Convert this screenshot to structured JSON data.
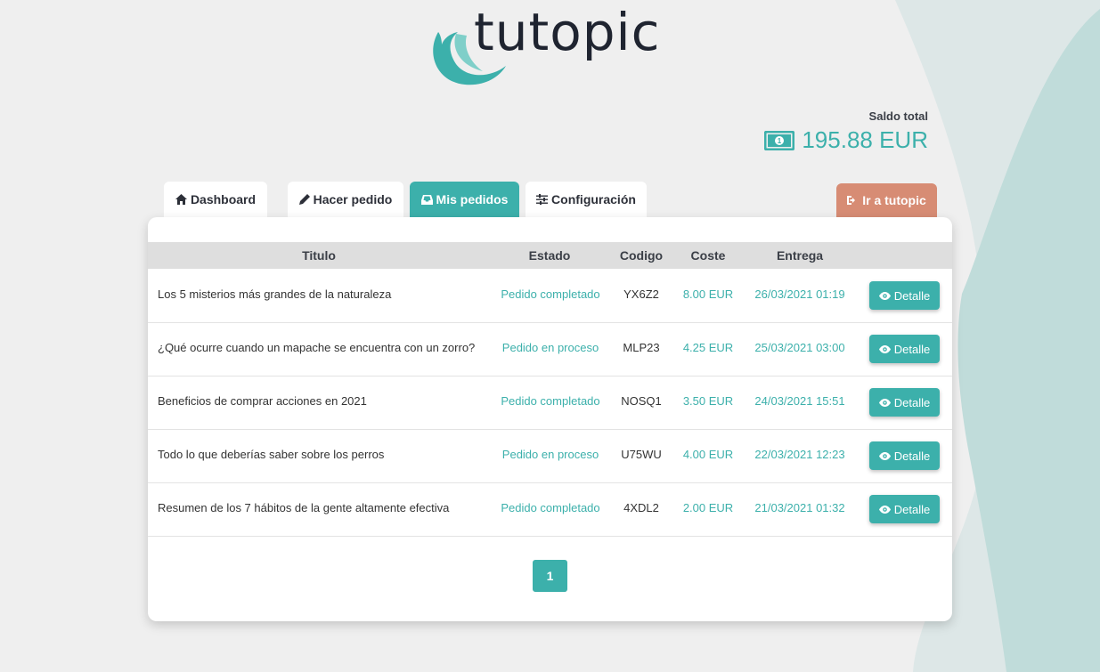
{
  "brand": {
    "logo_text": "tutopic",
    "accent": "#3cb0ab",
    "external_color": "#d78c74"
  },
  "balance": {
    "label": "Saldo total",
    "amount": "195.88 EUR",
    "icon": "money-bill-icon"
  },
  "tabs": [
    {
      "label": "Dashboard",
      "icon": "home-icon",
      "active": false
    },
    {
      "label": "Hacer pedido",
      "icon": "pencil-icon",
      "active": false
    },
    {
      "label": "Mis pedidos",
      "icon": "inbox-icon",
      "active": true
    },
    {
      "label": "Configuración",
      "icon": "sliders-icon",
      "active": false
    }
  ],
  "external": {
    "label": "Ir a tutopic",
    "icon": "sign-out-icon"
  },
  "table": {
    "headers": {
      "title": "Titulo",
      "status": "Estado",
      "code": "Codigo",
      "cost": "Coste",
      "delivery": "Entrega"
    },
    "rows": [
      {
        "title": "Los 5 misterios más grandes de la naturaleza",
        "status": "Pedido completado",
        "code": "YX6Z2",
        "cost": "8.00 EUR",
        "delivery": "26/03/2021 01:19",
        "action": "Detalle"
      },
      {
        "title": "¿Qué ocurre cuando un mapache se encuentra con un zorro?",
        "status": "Pedido en proceso",
        "code": "MLP23",
        "cost": "4.25 EUR",
        "delivery": "25/03/2021 03:00",
        "action": "Detalle"
      },
      {
        "title": "Beneficios de comprar acciones en 2021",
        "status": "Pedido completado",
        "code": "NOSQ1",
        "cost": "3.50 EUR",
        "delivery": "24/03/2021 15:51",
        "action": "Detalle"
      },
      {
        "title": "Todo lo que deberías saber sobre los perros",
        "status": "Pedido en proceso",
        "code": "U75WU",
        "cost": "4.00 EUR",
        "delivery": "22/03/2021 12:23",
        "action": "Detalle"
      },
      {
        "title": "Resumen de los 7 hábitos de la gente altamente efectiva",
        "status": "Pedido completado",
        "code": "4XDL2",
        "cost": "2.00 EUR",
        "delivery": "21/03/2021 01:32",
        "action": "Detalle"
      }
    ]
  },
  "pagination": {
    "current": "1"
  }
}
